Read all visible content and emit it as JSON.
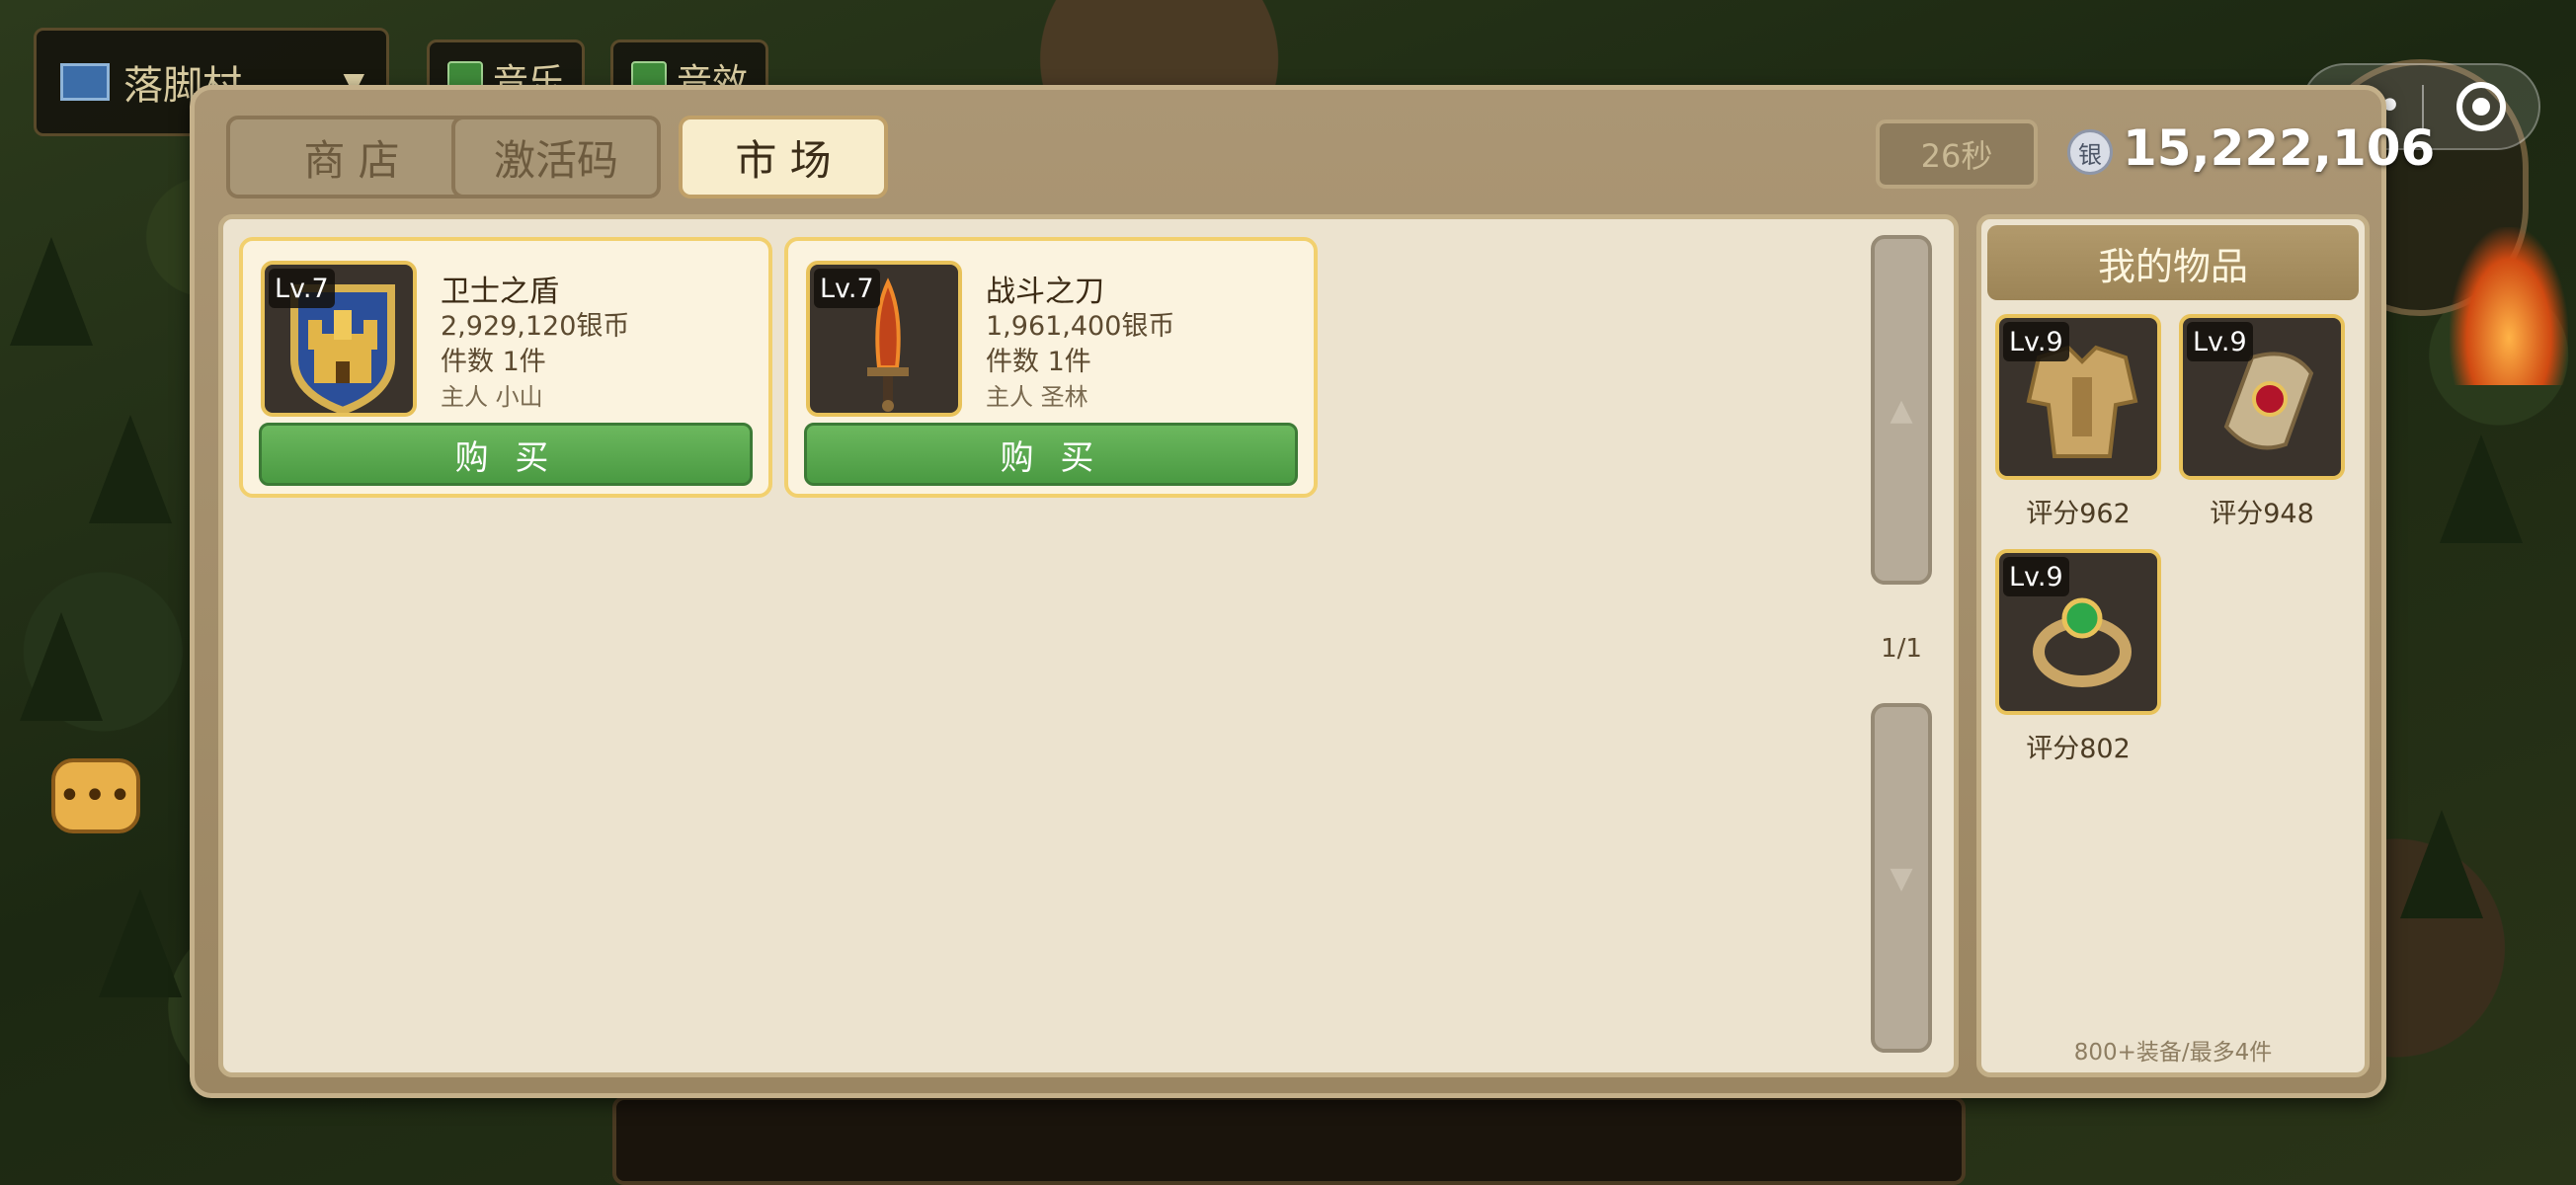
{
  "background": {
    "location": "落脚村",
    "options": [
      "音乐",
      "音效"
    ]
  },
  "capsule": {
    "more_label": "•••"
  },
  "tabs": [
    {
      "label": "商 店",
      "active": false
    },
    {
      "label": "激活码",
      "active": false
    },
    {
      "label": "市 场",
      "active": true
    }
  ],
  "timer": "26秒",
  "currency": {
    "icon_label": "银",
    "amount": "15,222,106"
  },
  "market": {
    "listings": [
      {
        "level": "Lv.7",
        "name": "卫士之盾",
        "price": "2,929,120银币",
        "quantity": "件数 1件",
        "owner": "主人 小山",
        "buy_label": "购 买",
        "icon": "castle-shield-icon"
      },
      {
        "level": "Lv.7",
        "name": "战斗之刀",
        "price": "1,961,400银币",
        "quantity": "件数 1件",
        "owner": "主人 圣林",
        "buy_label": "购 买",
        "icon": "flame-dagger-icon"
      }
    ],
    "page": "1/1",
    "scroll_up": "▲",
    "scroll_down": "▼"
  },
  "my_items": {
    "title": "我的物品",
    "items": [
      {
        "level": "Lv.9",
        "score": "评分962",
        "icon": "golden-armor-icon"
      },
      {
        "level": "Lv.9",
        "score": "评分948",
        "icon": "ruby-bracer-icon"
      },
      {
        "level": "Lv.9",
        "score": "评分802",
        "icon": "emerald-ring-icon"
      }
    ],
    "footer": "800+装备/最多4件"
  },
  "colors": {
    "buy_green": "#4a9a42",
    "panel_brown": "#9b8662",
    "highlight_gold": "#f2d06e"
  }
}
